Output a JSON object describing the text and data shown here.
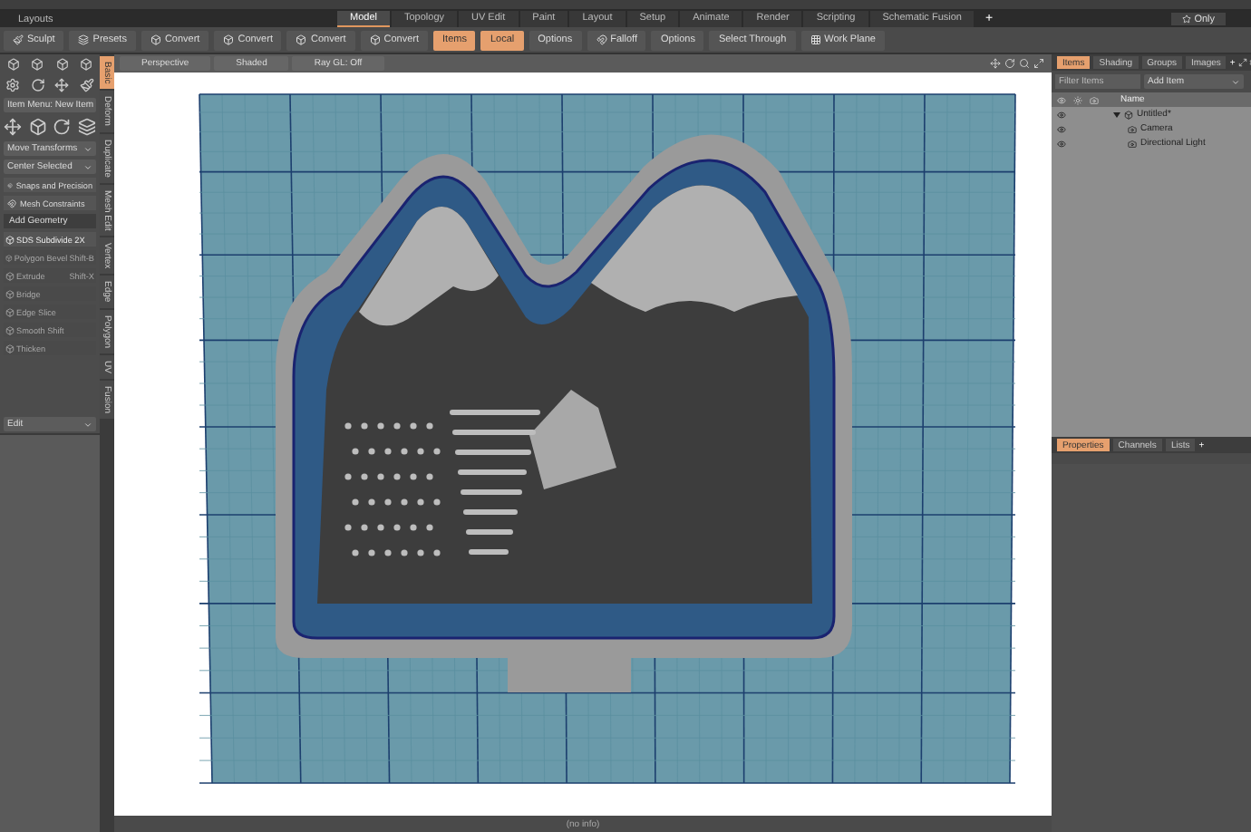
{
  "layout_bar": {
    "title": "Layouts",
    "tabs": [
      {
        "label": "Model",
        "selected": true
      },
      {
        "label": "Topology",
        "selected": false
      },
      {
        "label": "UV Edit",
        "selected": false
      },
      {
        "label": "Paint",
        "selected": false
      },
      {
        "label": "Layout",
        "selected": false
      },
      {
        "label": "Setup",
        "selected": false
      },
      {
        "label": "Animate",
        "selected": false
      },
      {
        "label": "Render",
        "selected": false
      },
      {
        "label": "Scripting",
        "selected": false
      },
      {
        "label": "Schematic Fusion",
        "selected": false
      }
    ],
    "add": "+",
    "only": "Only"
  },
  "toolbar": [
    {
      "label": "Sculpt",
      "selected": false
    },
    {
      "label": "Presets",
      "selected": false
    },
    {
      "label": "Convert",
      "selected": false
    },
    {
      "label": "Convert",
      "selected": false
    },
    {
      "label": "Convert",
      "selected": false
    },
    {
      "label": "Convert",
      "selected": false
    },
    {
      "label": "Items",
      "selected": true
    },
    {
      "label": "Local",
      "selected": true
    },
    {
      "label": "Options",
      "selected": false
    },
    {
      "label": "Falloff",
      "selected": false
    },
    {
      "label": "Options",
      "selected": false
    },
    {
      "label": "Select Through",
      "selected": false
    },
    {
      "label": "Work Plane",
      "selected": false
    }
  ],
  "left_panel": {
    "vertical_tabs": [
      {
        "label": "Basic",
        "selected": true
      },
      {
        "label": "Deform",
        "selected": false
      },
      {
        "label": "Duplicate",
        "selected": false
      },
      {
        "label": "Mesh Edit",
        "selected": false
      },
      {
        "label": "Vertex",
        "selected": false
      },
      {
        "label": "Edge",
        "selected": false
      },
      {
        "label": "Polygon",
        "selected": false
      },
      {
        "label": "UV",
        "selected": false
      },
      {
        "label": "Fusion",
        "selected": false
      }
    ],
    "item_menu": "Item Menu: New Item",
    "dropdowns": [
      "Move Transforms",
      "Center Selected"
    ],
    "toggles": [
      "Snaps and Precision",
      "Mesh Constraints"
    ],
    "section": "Add Geometry",
    "tools": [
      {
        "label": "SDS Subdivide 2X",
        "disabled": false
      },
      {
        "label": "Polygon Bevel",
        "shortcut": "Shift-B",
        "disabled": true
      },
      {
        "label": "Extrude",
        "shortcut": "Shift-X",
        "disabled": true
      },
      {
        "label": "Bridge",
        "disabled": true
      },
      {
        "label": "Edge Slice",
        "disabled": true
      },
      {
        "label": "Smooth Shift",
        "disabled": true
      },
      {
        "label": "Thicken",
        "disabled": true
      }
    ],
    "bottom_dropdown": "Edit"
  },
  "viewport": {
    "header": [
      "Perspective",
      "Shaded",
      "Ray GL: Off"
    ],
    "status": "(no info)"
  },
  "right_panel": {
    "tabs": [
      {
        "label": "Items",
        "selected": true
      },
      {
        "label": "Shading",
        "selected": false
      },
      {
        "label": "Groups",
        "selected": false
      },
      {
        "label": "Images",
        "selected": false
      }
    ],
    "add_tab": "+",
    "filter_placeholder": "Filter Items",
    "add_item": "Add Item",
    "column": "Name",
    "tree": [
      {
        "label": "Untitled*",
        "expanded": true,
        "children": [
          {
            "label": "Camera"
          },
          {
            "label": "Directional Light"
          }
        ]
      }
    ],
    "bottom_tabs": [
      {
        "label": "Properties",
        "selected": true
      },
      {
        "label": "Channels",
        "selected": false
      },
      {
        "label": "Lists",
        "selected": false
      }
    ],
    "bottom_add": "+"
  }
}
